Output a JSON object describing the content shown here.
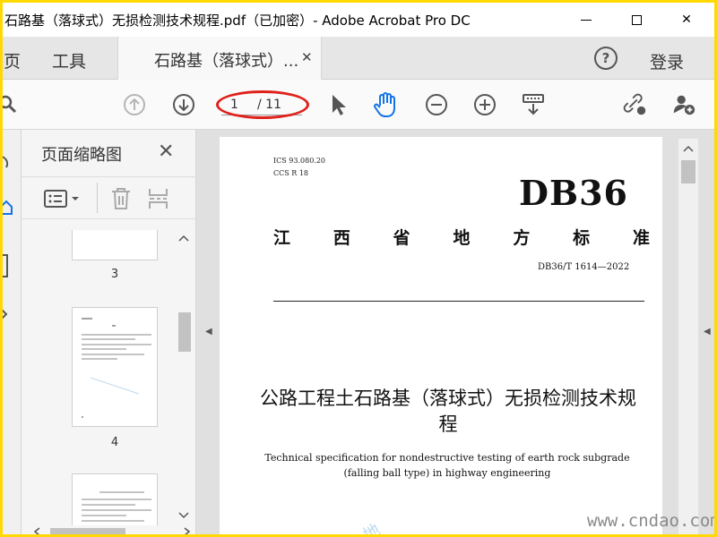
{
  "window": {
    "title": "石路基（落球式）无损检测技术规程.pdf（已加密）- Adobe Acrobat Pro DC",
    "watermark": "泼发"
  },
  "tabs": {
    "home": "主页",
    "tools": "工具",
    "document": "石路基（落球式）...",
    "login": "登录"
  },
  "toolbar": {
    "current_page": "1",
    "total_pages": "/ 11"
  },
  "thumbnail_panel": {
    "title": "页面缩略图",
    "pages": [
      {
        "label": "3"
      },
      {
        "label": "4"
      }
    ]
  },
  "document": {
    "ics_lines": [
      "ICS 93.080.20",
      "CCS R 18"
    ],
    "code": "DB36",
    "province_chars": [
      "江",
      "西",
      "省",
      "地",
      "方",
      "标",
      "准"
    ],
    "standard_number": "DB36/T 1614—2022",
    "title_cn": "公路工程土石路基（落球式）无损检测技术规程",
    "title_en": "Technical specification for nondestructive testing of earth rock subgrade (falling ball type) in highway engineering"
  },
  "overlay": {
    "site_watermark": "www.cndao.com"
  },
  "colors": {
    "highlight_ellipse": "#e0201a",
    "accent_hand": "#1473e6",
    "frame": "#ffd900"
  }
}
